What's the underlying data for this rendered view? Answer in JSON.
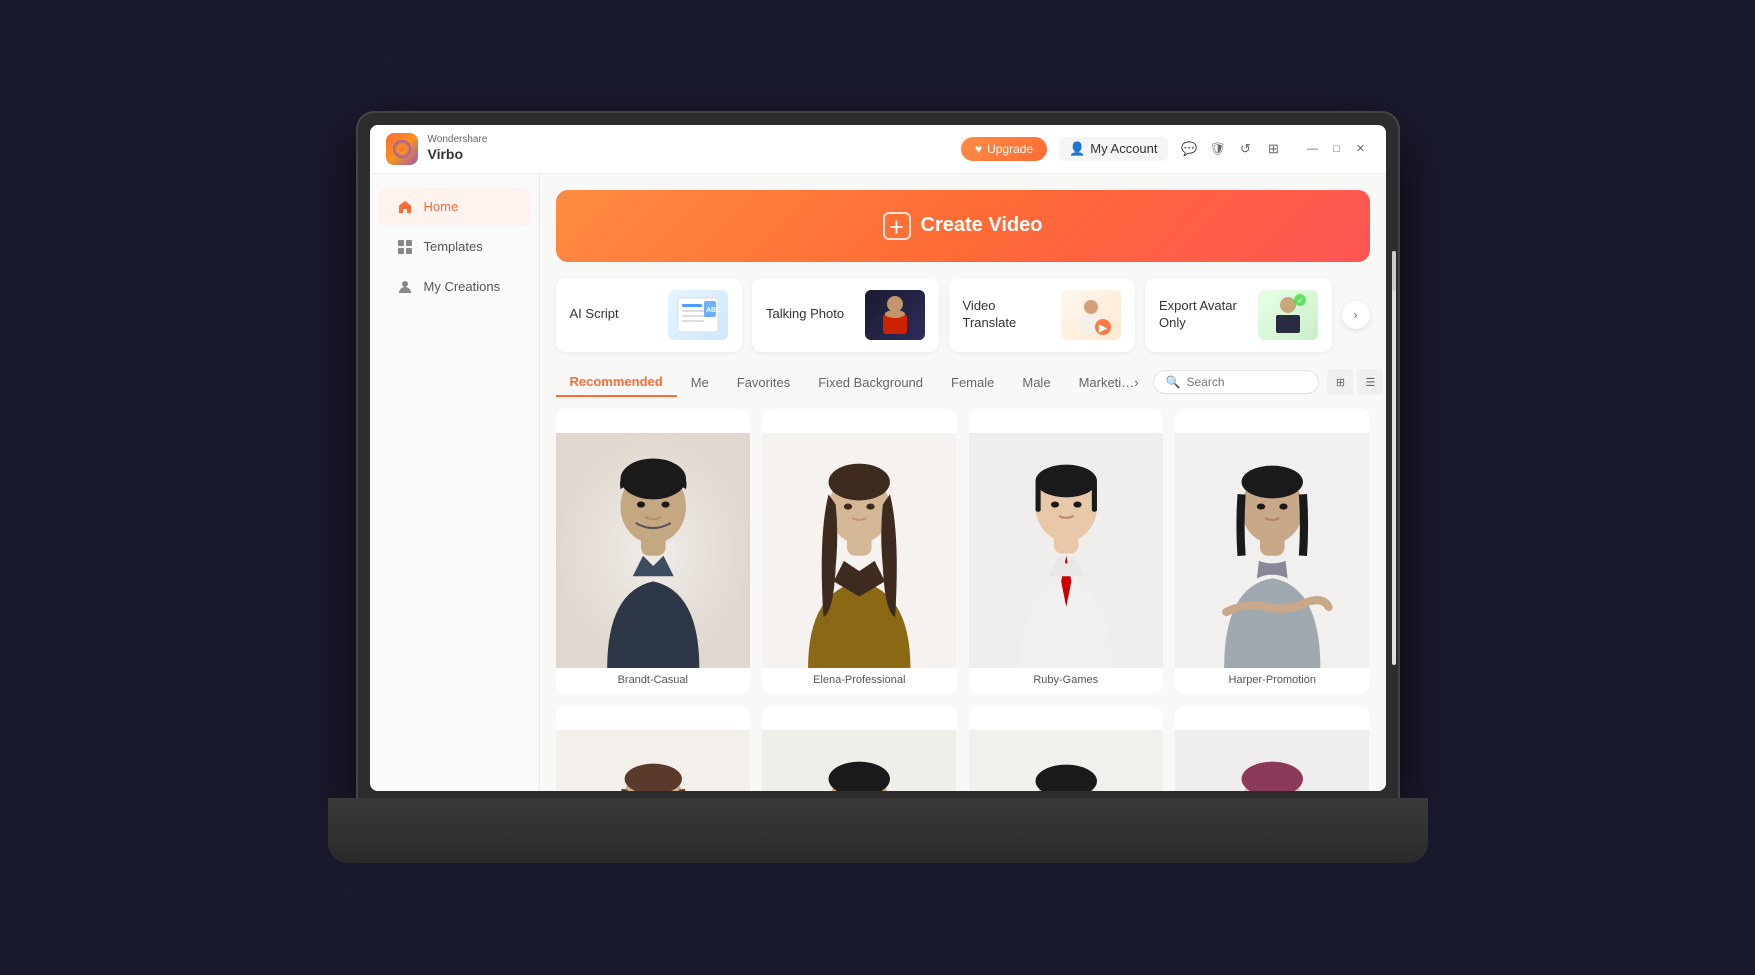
{
  "app": {
    "brand_top": "Wondershare",
    "brand_name": "Virbo"
  },
  "titlebar": {
    "upgrade_label": "Upgrade",
    "my_account_label": "My Account"
  },
  "window_controls": {
    "minimize": "—",
    "maximize": "□",
    "close": "✕"
  },
  "sidebar": {
    "items": [
      {
        "id": "home",
        "label": "Home",
        "active": true
      },
      {
        "id": "templates",
        "label": "Templates",
        "active": false
      },
      {
        "id": "my-creations",
        "label": "My Creations",
        "active": false
      }
    ]
  },
  "create_video": {
    "label": "Create Video"
  },
  "feature_cards": [
    {
      "id": "ai-script",
      "label": "AI Script"
    },
    {
      "id": "talking-photo",
      "label": "Talking Photo"
    },
    {
      "id": "video-translate",
      "label": "Video\nTranslate"
    },
    {
      "id": "export-avatar",
      "label": "Export Avatar Only"
    }
  ],
  "categories": {
    "tabs": [
      {
        "id": "recommended",
        "label": "Recommended",
        "active": true
      },
      {
        "id": "me",
        "label": "Me",
        "active": false
      },
      {
        "id": "favorites",
        "label": "Favorites",
        "active": false
      },
      {
        "id": "fixed-bg",
        "label": "Fixed Background",
        "active": false
      },
      {
        "id": "female",
        "label": "Female",
        "active": false
      },
      {
        "id": "male",
        "label": "Male",
        "active": false
      },
      {
        "id": "marketing",
        "label": "Marketi…",
        "active": false
      }
    ],
    "search_placeholder": "Search"
  },
  "avatars": [
    {
      "id": "brandt",
      "label": "Brandt-Casual",
      "bg": "av1",
      "skin": "#c4a882",
      "shirt": "#2d3748",
      "hair": "#1a1a1a"
    },
    {
      "id": "elena",
      "label": "Elena-Professional",
      "bg": "av2",
      "skin": "#d4b896",
      "shirt": "#8b6914",
      "hair": "#3d2b1f"
    },
    {
      "id": "ruby",
      "label": "Ruby-Games",
      "bg": "av3",
      "skin": "#e8c8a8",
      "shirt": "#f0f0f0",
      "hair": "#1a1a1a"
    },
    {
      "id": "harper",
      "label": "Harper-Promotion",
      "bg": "av4",
      "skin": "#c8a888",
      "shirt": "#a0a8b0",
      "hair": "#1a1a1a"
    },
    {
      "id": "avatar5",
      "label": "",
      "bg": "av5",
      "skin": "#d4b090",
      "shirt": "#c4892a",
      "hair": "#5a3a2a"
    },
    {
      "id": "avatar6",
      "label": "",
      "bg": "av6",
      "skin": "#d0a878",
      "shirt": "#8bb8c8",
      "hair": "#1a1a1a"
    },
    {
      "id": "avatar7",
      "label": "",
      "bg": "av7",
      "skin": "#d8c0a8",
      "shirt": "#f0f0f0",
      "hair": "#1a1a1a"
    },
    {
      "id": "avatar8",
      "label": "",
      "bg": "av8",
      "skin": "#e0b8c0",
      "shirt": "#b0a0d0",
      "hair": "#8b3a5a"
    }
  ]
}
